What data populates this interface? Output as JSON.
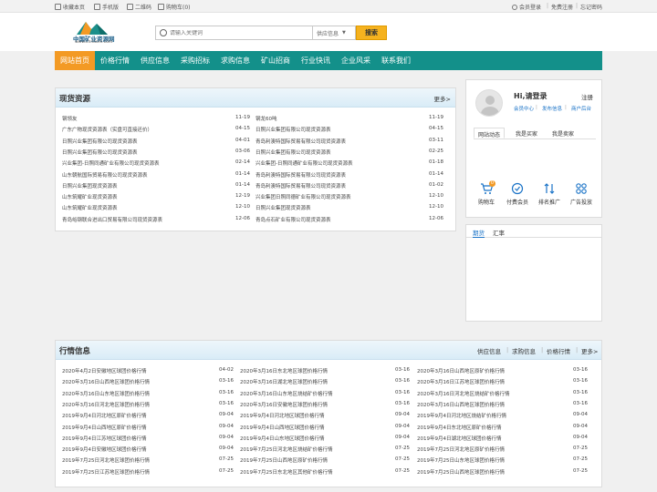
{
  "topbar": {
    "fav": "收藏本页",
    "mobile": "手机版",
    "qrcode": "二维码",
    "cart": "购物车(0)",
    "login": "会员登录",
    "register": "免费注册",
    "forgot": "忘记密码",
    "sep": "|"
  },
  "header": {
    "logo_text": "中国矿业资源网",
    "logo_url": "www.chnaore.com",
    "search_placeholder": "请输入关键词",
    "search_select": "供应信息",
    "search_button": "搜索"
  },
  "nav": {
    "items": [
      "网站首页",
      "价格行情",
      "供应信息",
      "采购招标",
      "求购信息",
      "矿山招商",
      "行业快讯",
      "企业风采",
      "联系我们"
    ]
  },
  "spot": {
    "title": "现货资源",
    "more": "更多>",
    "left": [
      {
        "text": "钢领友",
        "date": "11-19"
      },
      {
        "text": "广东广物现货资源表（实盘可直接还价）",
        "date": "04-15"
      },
      {
        "text": "日照兴业集团有限公司现货资源表",
        "date": "04-01"
      },
      {
        "text": "日照兴业集团有限公司现货资源表",
        "date": "03-06"
      },
      {
        "text": "兴业集团-日照同通矿业有限公司现货资源表",
        "date": "02-14"
      },
      {
        "text": "山东朝航国际贸易有限公司现货资源表",
        "date": "01-14"
      },
      {
        "text": "日照兴业集团现货资源表",
        "date": "01-14"
      },
      {
        "text": "山东筑耀矿业现货资源表",
        "date": "12-19"
      },
      {
        "text": "山东筑耀矿业现货资源表",
        "date": "12-10"
      },
      {
        "text": "青岛峪钢联合进出口贸易有限公司现货资源表",
        "date": "12-06"
      }
    ],
    "right": [
      {
        "text": "钢龙60吨",
        "date": "11-19"
      },
      {
        "text": "日照兴业集团有限公司现货资源表",
        "date": "04-15"
      },
      {
        "text": "青岛利澳特国际贸易有限公司现货资源表",
        "date": "03-11"
      },
      {
        "text": "日照兴业集团有限公司现货资源表",
        "date": "02-25"
      },
      {
        "text": "兴业集团-日照同通矿业有限公司现货资源表",
        "date": "01-18"
      },
      {
        "text": "青岛利澳特国际贸易有限公司现货资源表",
        "date": "01-14"
      },
      {
        "text": "青岛利澳特国际贸易有限公司现货资源表",
        "date": "01-02"
      },
      {
        "text": "兴业集团日照同德矿业有限公司现货资源表",
        "date": "12-10"
      },
      {
        "text": "日照兴业集团现货资源表",
        "date": "12-10"
      },
      {
        "text": "青岛点石矿业有限公司现货资源表",
        "date": "12-06"
      }
    ]
  },
  "account": {
    "greeting": "Hi,请登录",
    "register": "注册",
    "links": [
      "会员中心",
      "发布信息",
      "商户后台"
    ],
    "tabs": [
      "网站动态",
      "我是买家",
      "我是卖家"
    ],
    "services": [
      {
        "label": "购物车",
        "icon": "cart-icon",
        "badge": "0"
      },
      {
        "label": "付费会员",
        "icon": "member-icon"
      },
      {
        "label": "排名推广",
        "icon": "ranking-icon"
      },
      {
        "label": "广告投放",
        "icon": "ad-icon"
      }
    ]
  },
  "futures": {
    "tabs": [
      "期货",
      "汇率"
    ]
  },
  "market": {
    "title": "行情信息",
    "links": [
      "供应信息",
      "求购信息",
      "价格行情",
      "更多>"
    ],
    "cols": [
      [
        {
          "text": "2020年4月2日安徽地区球团价格行情",
          "date": "04-02"
        },
        {
          "text": "2020年3月16日山西地区球团价格行情",
          "date": "03-16"
        },
        {
          "text": "2020年3月16日山东地区球团价格行情",
          "date": "03-16"
        },
        {
          "text": "2020年3月16日河北地区球团价格行情",
          "date": "03-16"
        },
        {
          "text": "2019年9月4日河北地区原矿价格行情",
          "date": "09-04"
        },
        {
          "text": "2019年9月4日山西地区原矿价格行情",
          "date": "09-04"
        },
        {
          "text": "2019年9月4日江苏地区球团价格行情",
          "date": "09-04"
        },
        {
          "text": "2019年9月4日安徽地区球团价格行情",
          "date": "09-04"
        },
        {
          "text": "2019年7月25日河北地区球团价格行情",
          "date": "07-25"
        },
        {
          "text": "2019年7月25日江苏地区球团价格行情",
          "date": "07-25"
        }
      ],
      [
        {
          "text": "2020年3月16日东北地区球团价格行情",
          "date": "03-16"
        },
        {
          "text": "2020年3月16日湖北地区球团价格行情",
          "date": "03-16"
        },
        {
          "text": "2020年3月16日山东地区烧结矿价格行情",
          "date": "03-16"
        },
        {
          "text": "2020年3月16日安徽地区球团价格行情",
          "date": "03-16"
        },
        {
          "text": "2019年9月4日河北地区球团价格行情",
          "date": "09-04"
        },
        {
          "text": "2019年9月4日山西地区球团价格行情",
          "date": "09-04"
        },
        {
          "text": "2019年9月4日山东地区球团价格行情",
          "date": "09-04"
        },
        {
          "text": "2019年7月25日河北地区烧结矿价格行情",
          "date": "07-25"
        },
        {
          "text": "2019年7月25日山西地区原矿价格行情",
          "date": "07-25"
        },
        {
          "text": "2019年7月25日东北地区其他矿价格行情",
          "date": "07-25"
        }
      ],
      [
        {
          "text": "2020年3月16日山西地区原矿价格行情",
          "date": "03-16"
        },
        {
          "text": "2020年3月16日江苏地区球团价格行情",
          "date": "03-16"
        },
        {
          "text": "2020年3月16日河北地区烧结矿价格行情",
          "date": "03-16"
        },
        {
          "text": "2020年3月16日山西地区球团价格行情",
          "date": "03-16"
        },
        {
          "text": "2019年9月4日河北地区烧结矿价格行情",
          "date": "09-04"
        },
        {
          "text": "2019年9月4日东北地区原矿价格行情",
          "date": "09-04"
        },
        {
          "text": "2019年9月4日湖北地区球团价格行情",
          "date": "09-04"
        },
        {
          "text": "2019年7月25日河北地区原矿价格行情",
          "date": "07-25"
        },
        {
          "text": "2019年7月25日山东地区球团价格行情",
          "date": "07-25"
        },
        {
          "text": "2019年7月25日山西地区球团价格行情",
          "date": "07-25"
        }
      ]
    ]
  },
  "colors": {
    "nav": "#13908a",
    "nav_active": "#f39a24",
    "search_button": "#f5b21f",
    "link_blue": "#1a73c7"
  }
}
